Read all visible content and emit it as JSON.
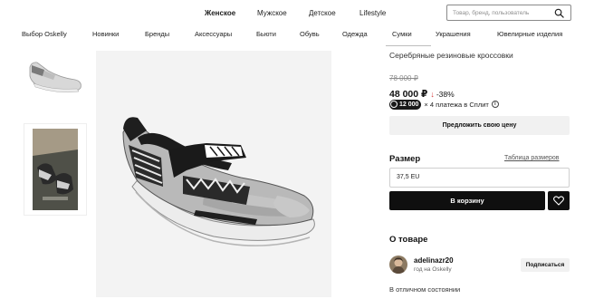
{
  "header": {
    "tabs": [
      {
        "label": "Женское",
        "active": true
      },
      {
        "label": "Мужское",
        "active": false
      },
      {
        "label": "Детское",
        "active": false
      },
      {
        "label": "Lifestyle",
        "active": false
      }
    ],
    "search": {
      "placeholder": "Товар, бренд, пользователь",
      "icon": "search-icon"
    }
  },
  "categories": [
    "Выбор Oskelly",
    "Новинки",
    "Бренды",
    "Аксессуары",
    "Бьюти",
    "Обувь",
    "Одежда",
    "Сумки",
    "Украшения",
    "Ювелирные изделия"
  ],
  "gallery": {
    "thumbnails": [
      "thumbnail-1",
      "thumbnail-2"
    ]
  },
  "product": {
    "title": "Серебряные резиновые кроссовки",
    "old_price": "78 000 ₽",
    "price": "48 000 ₽",
    "discount_arrow": "↓",
    "discount": "-38%",
    "split_amount": "12 000",
    "split_text": "× 4 платежа в Сплит",
    "offer_button": "Предложить свою цену"
  },
  "size": {
    "label": "Размер",
    "table_link": "Таблица размеров",
    "selected": "37,5 EU"
  },
  "actions": {
    "cart_button": "В корзину",
    "favorite_icon": "heart-icon"
  },
  "about": {
    "title": "О товаре",
    "seller_name": "adelinazr20",
    "seller_meta": "год на Oskelly",
    "subscribe_button": "Подписаться",
    "condition": "В отличном состоянии"
  },
  "colors": {
    "accent": "#0f0f0f",
    "discount_red": "#d63b3b",
    "button_gray": "#f1f1f1"
  }
}
